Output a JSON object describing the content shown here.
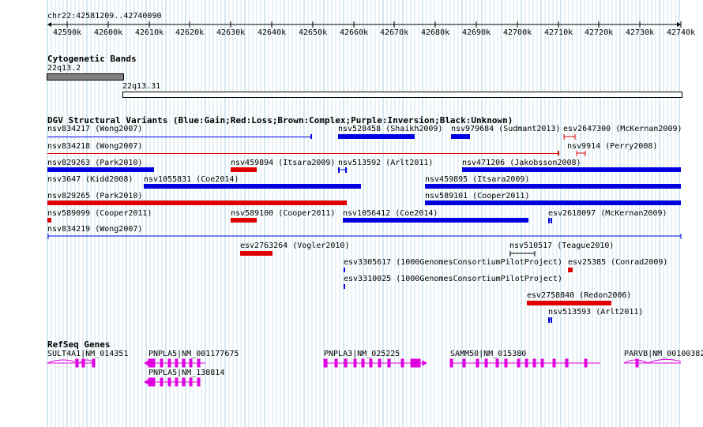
{
  "browser": {
    "position": "chr22:42581209..42740090",
    "ruler_ticks": [
      "42590k",
      "42600k",
      "42610k",
      "42620k",
      "42630k",
      "42640k",
      "42650k",
      "42660k",
      "42670k",
      "42680k",
      "42690k",
      "42700k",
      "42710k",
      "42720k",
      "42730k",
      "42740k"
    ]
  },
  "cytobands": {
    "title": "Cytogenetic Bands",
    "band1": "22q13.2",
    "band2": "22q13.31"
  },
  "dgv": {
    "title": "DGV Structural Variants (Blue:Gain;Red:Loss;Brown:Complex;Purple:Inversion;Black:Unknown)",
    "variants": [
      {
        "label": "nsv834217 (Wong2007)",
        "color": "#0000e0"
      },
      {
        "label": "nsv528458 (Shaikh2009)",
        "color": "#0000e0"
      },
      {
        "label": "nsv979684 (Sudmant2013)",
        "color": "#0000e0"
      },
      {
        "label": "esv2647300 (McKernan2009)",
        "color": "#e00000"
      },
      {
        "label": "nsv834218 (Wong2007)",
        "color": "#e00000"
      },
      {
        "label": "nsv9914 (Perry2008)",
        "color": "#e00000"
      },
      {
        "label": "nsv829263 (Park2010)",
        "color": "#0000e0"
      },
      {
        "label": "nsv459894 (Itsara2009)",
        "color": "#e00000"
      },
      {
        "label": "nsv513592 (Arlt2011)",
        "color": "#0000e0"
      },
      {
        "label": "nsv471206 (Jakobsson2008)",
        "color": "#0000e0"
      },
      {
        "label": "nsv3647 (Kidd2008)",
        "color": "#0000e0"
      },
      {
        "label": "nsv1055831 (Coe2014)",
        "color": "#0000e0"
      },
      {
        "label": "nsv459895 (Itsara2009)",
        "color": "#0000e0"
      },
      {
        "label": "nsv829265 (Park2010)",
        "color": "#e00000"
      },
      {
        "label": "nsv589101 (Cooper2011)",
        "color": "#0000e0"
      },
      {
        "label": "nsv589099 (Cooper2011)",
        "color": "#e00000"
      },
      {
        "label": "nsv589100 (Cooper2011)",
        "color": "#e00000"
      },
      {
        "label": "nsv1056412 (Coe2014)",
        "color": "#0000e0"
      },
      {
        "label": "esv2618097 (McKernan2009)",
        "color": "#0000e0"
      },
      {
        "label": "nsv834219 (Wong2007)",
        "color": "#0000e0"
      },
      {
        "label": "esv2763264 (Vogler2010)",
        "color": "#e00000"
      },
      {
        "label": "nsv510517 (Teague2010)",
        "color": "#000000"
      },
      {
        "label": "esv3305617 (1000GenomesConsortiumPilotProject)",
        "color": "#0000e0"
      },
      {
        "label": "esv25385 (Conrad2009)",
        "color": "#e00000"
      },
      {
        "label": "esv3310025 (1000GenomesConsortiumPilotProject)",
        "color": "#0000e0"
      },
      {
        "label": "esv2758840 (Redon2006)",
        "color": "#e00000"
      },
      {
        "label": "nsv513593 (Arlt2011)",
        "color": "#0000e0"
      }
    ]
  },
  "refseq": {
    "title": "RefSeq Genes",
    "genes": [
      {
        "label": "SULT4A1|NM_014351"
      },
      {
        "label": "PNPLA5|NM_001177675"
      },
      {
        "label": "PNPLA5|NM_138814"
      },
      {
        "label": "PNPLA3|NM_025225"
      },
      {
        "label": "SAMM50|NM_015380"
      },
      {
        "label": "PARVB|NM_00100382"
      }
    ],
    "color": "#e000e0"
  },
  "colors": {
    "grid": "#b8dce8",
    "gain": "#0000e0",
    "loss": "#e00000",
    "band_dark": "#808080"
  }
}
